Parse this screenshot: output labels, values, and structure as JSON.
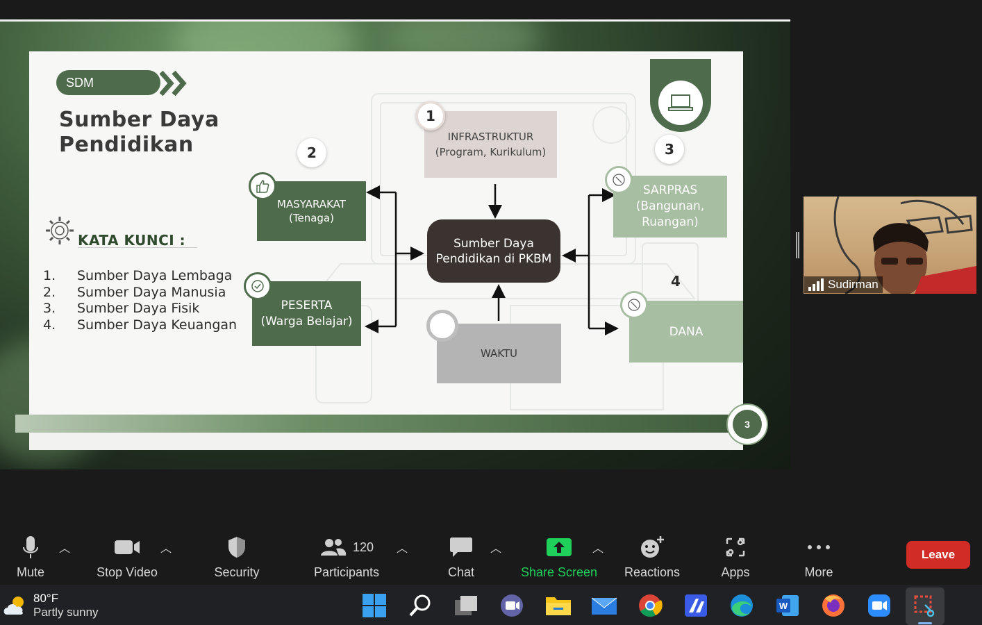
{
  "slide": {
    "tag": "SDM",
    "title": "Sumber Daya Pendidikan",
    "kata_kunci": "KATA KUNCI :",
    "keywords": [
      {
        "num": "1.",
        "text": "Sumber Daya Lembaga"
      },
      {
        "num": "2.",
        "text": "Sumber Daya Manusia"
      },
      {
        "num": "3.",
        "text": "Sumber Daya Fisik"
      },
      {
        "num": "4.",
        "text": "Sumber Daya Keuangan"
      }
    ],
    "center": "Sumber Daya Pendidikan di PKBM",
    "boxes": {
      "infrastruktur": {
        "num": "1",
        "line1": "INFRASTRUKTUR",
        "line2": "(Program, Kurikulum)"
      },
      "masyarakat": {
        "num": "2",
        "line1": "MASYARAKAT",
        "line2": "(Tenaga)"
      },
      "peserta": {
        "line1": "PESERTA",
        "line2": "(Warga Belajar)"
      },
      "sarpras": {
        "num": "3",
        "line1": "SARPRAS",
        "line2": "(Bangunan,",
        "line3": "Ruangan)"
      },
      "dana": {
        "num": "4",
        "line1": "DANA"
      },
      "waktu": {
        "line1": "WAKTU"
      }
    },
    "page_number": "3"
  },
  "participant": {
    "name": "Sudirman"
  },
  "toolbar": {
    "mute": "Mute",
    "stop_video": "Stop Video",
    "security": "Security",
    "participants": "Participants",
    "participants_count": "120",
    "chat": "Chat",
    "share_screen": "Share Screen",
    "reactions": "Reactions",
    "apps": "Apps",
    "more": "More",
    "leave": "Leave"
  },
  "taskbar": {
    "temperature": "80°F",
    "condition": "Partly sunny"
  },
  "colors": {
    "dark_green": "#4e6b4b",
    "light_green": "#a8bea2",
    "share_green": "#1fd05a",
    "leave_red": "#d12d26"
  }
}
